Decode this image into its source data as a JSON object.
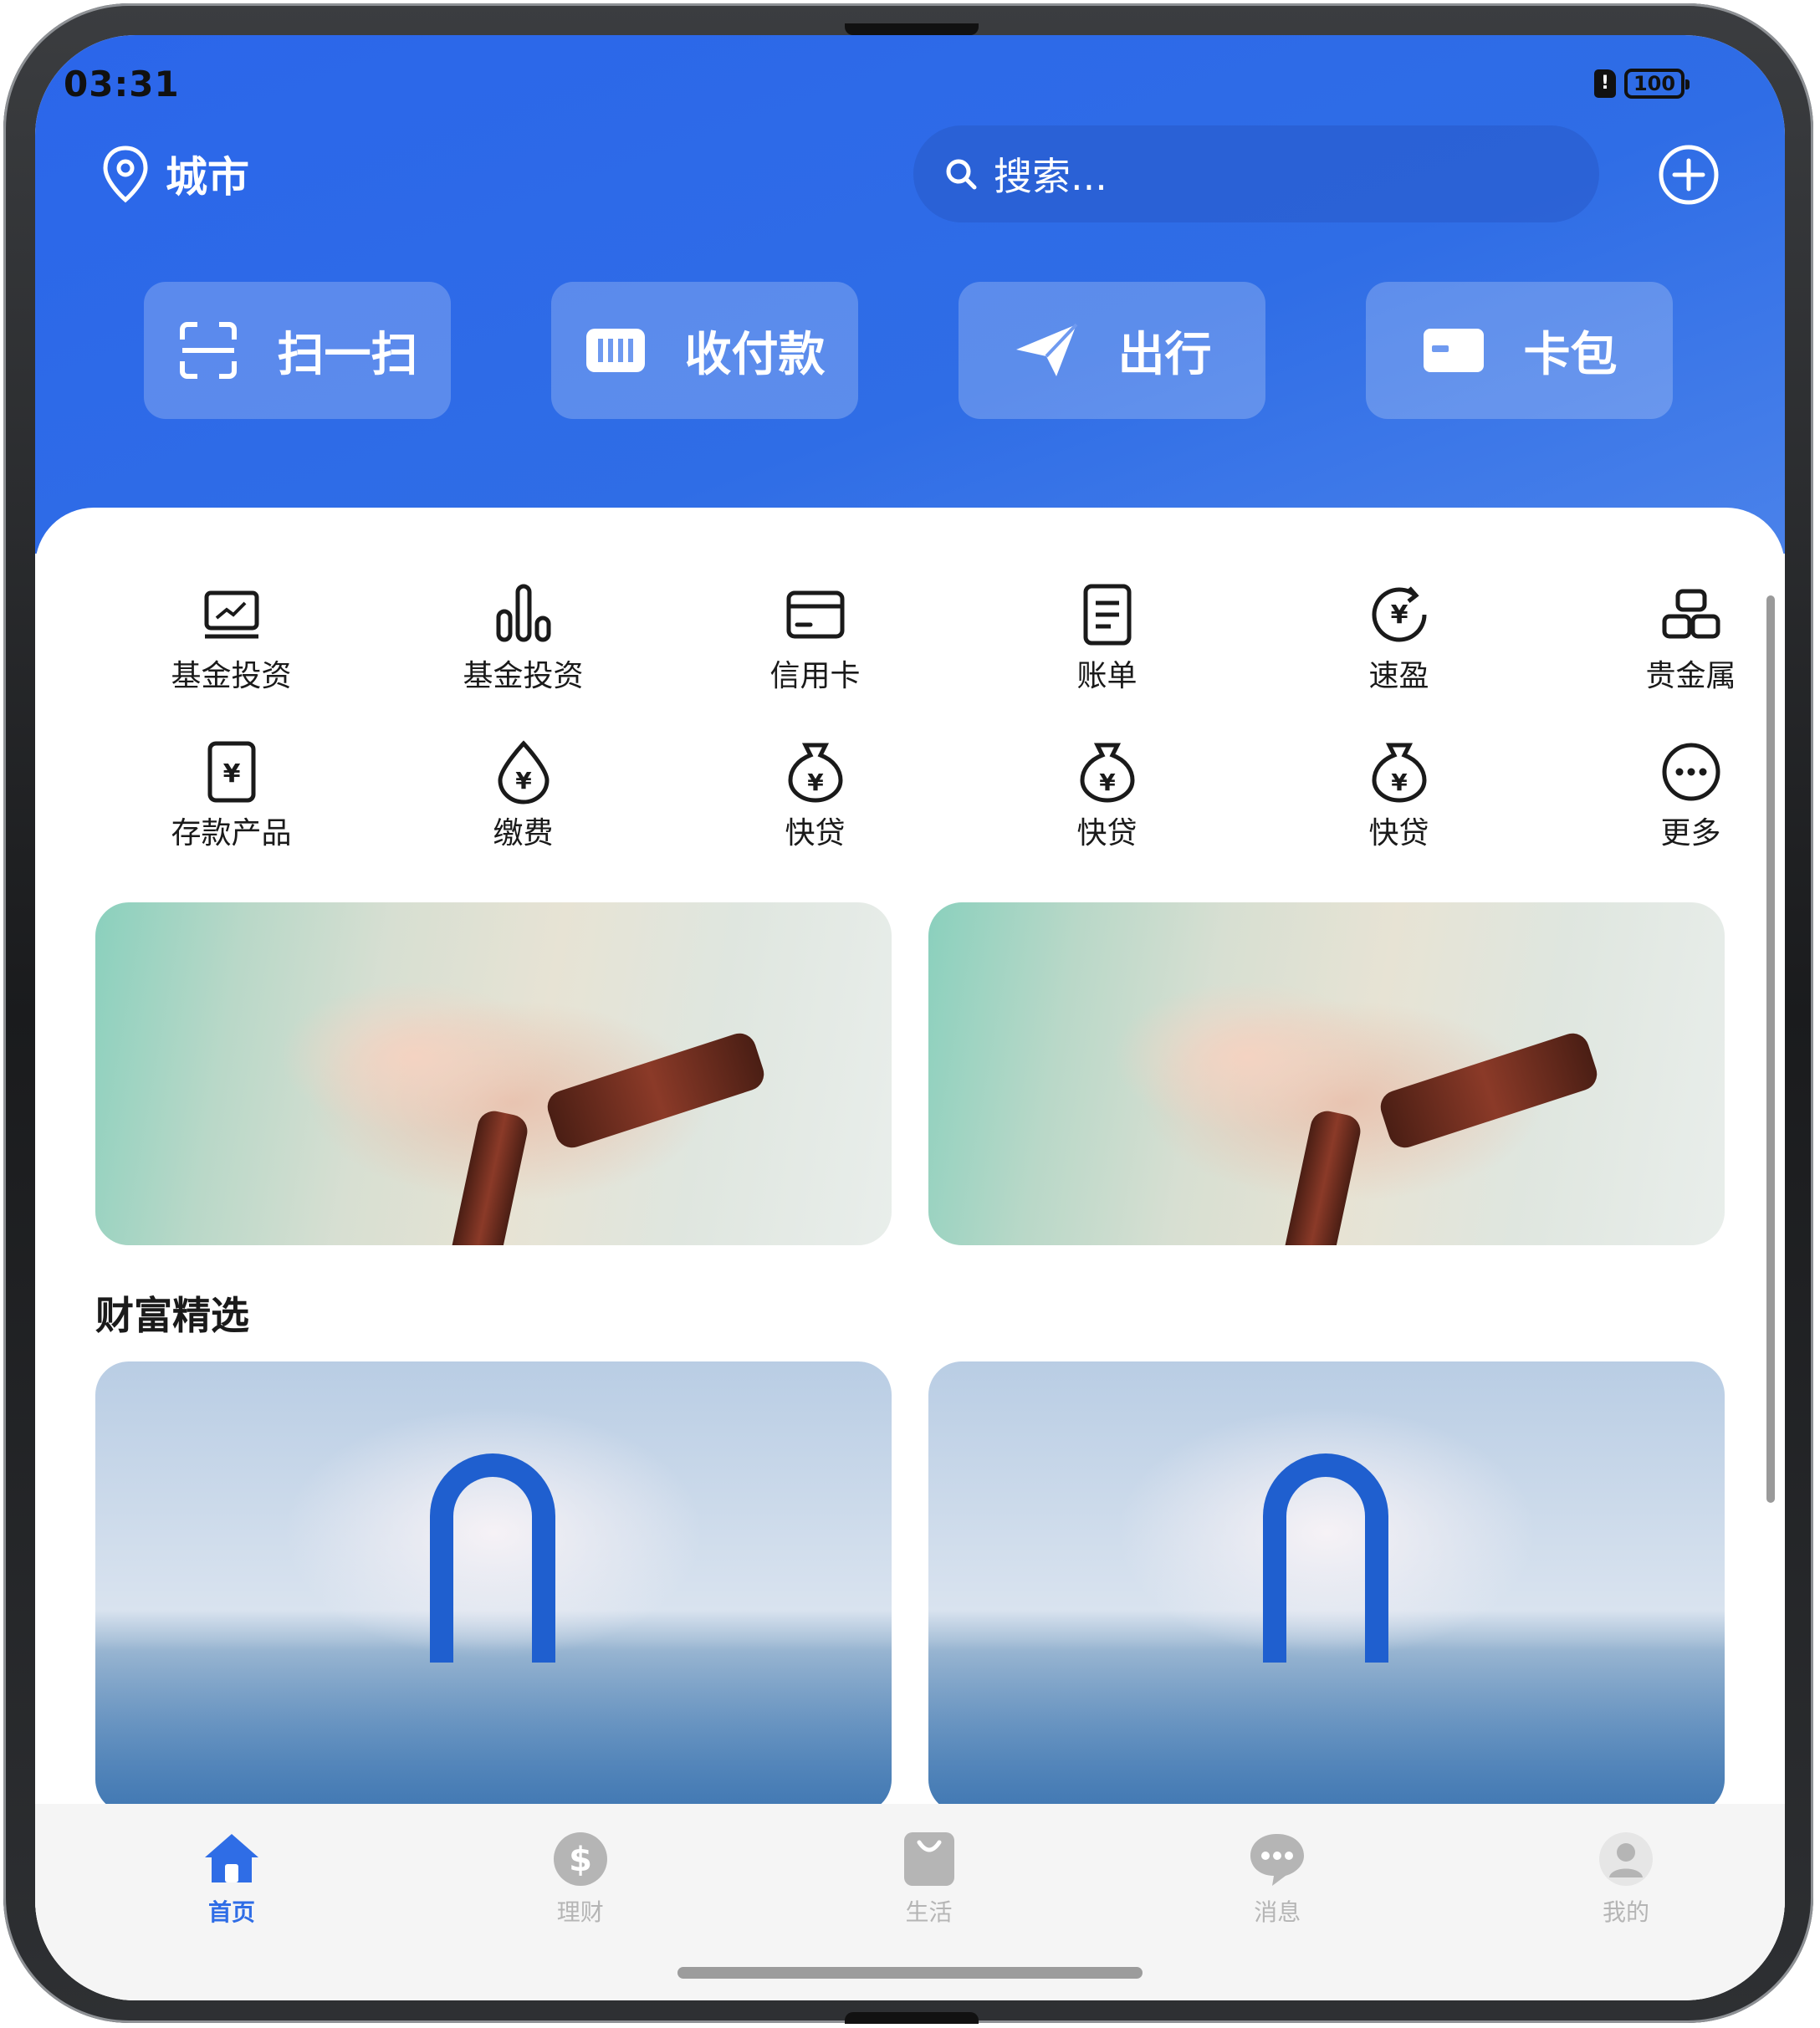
{
  "status_bar": {
    "time": "03:31",
    "battery": "100"
  },
  "header": {
    "city": "城市",
    "search_placeholder": "搜索...",
    "quick_actions": [
      {
        "label": "扫一扫",
        "icon": "scan-icon"
      },
      {
        "label": "收付款",
        "icon": "barcode-icon"
      },
      {
        "label": "出行",
        "icon": "paper-plane-icon"
      },
      {
        "label": "卡包",
        "icon": "card-icon"
      }
    ]
  },
  "services": [
    {
      "label": "基金投资",
      "icon": "chart-icon"
    },
    {
      "label": "基金投资",
      "icon": "bar-chart-icon"
    },
    {
      "label": "信用卡",
      "icon": "credit-card-icon"
    },
    {
      "label": "账单",
      "icon": "bill-icon"
    },
    {
      "label": "速盈",
      "icon": "yen-refresh-icon"
    },
    {
      "label": "贵金属",
      "icon": "gold-bars-icon"
    },
    {
      "label": "存款产品",
      "icon": "yen-card-icon"
    },
    {
      "label": "缴费",
      "icon": "yen-drop-icon"
    },
    {
      "label": "快贷",
      "icon": "money-bag-icon"
    },
    {
      "label": "快贷",
      "icon": "money-bag-icon"
    },
    {
      "label": "快贷",
      "icon": "money-bag-icon"
    },
    {
      "label": "更多",
      "icon": "more-icon"
    }
  ],
  "section_title": "财富精选",
  "tabs": [
    {
      "label": "首页",
      "icon": "home-icon",
      "active": true
    },
    {
      "label": "理财",
      "icon": "dollar-icon",
      "active": false
    },
    {
      "label": "生活",
      "icon": "bag-icon",
      "active": false
    },
    {
      "label": "消息",
      "icon": "chat-icon",
      "active": false
    },
    {
      "label": "我的",
      "icon": "user-icon",
      "active": false
    }
  ],
  "colors": {
    "brand_blue": "#2f6de6",
    "tab_inactive": "#b5b5b5"
  }
}
